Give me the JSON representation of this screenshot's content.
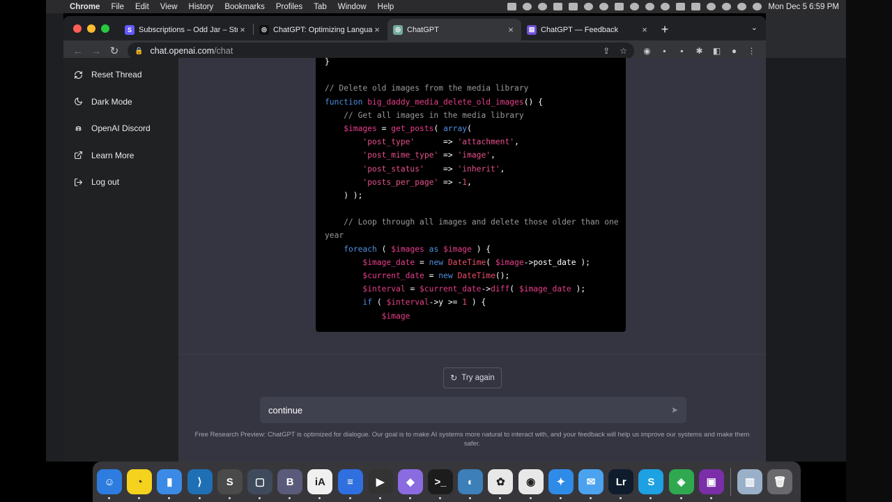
{
  "menubar": {
    "apple": "",
    "items": [
      "Chrome",
      "File",
      "Edit",
      "View",
      "History",
      "Bookmarks",
      "Profiles",
      "Tab",
      "Window",
      "Help"
    ],
    "clock": "Mon Dec 5  6:59 PM"
  },
  "browser": {
    "tabs": [
      {
        "title": "Subscriptions – Odd Jar – Strip",
        "fav": "S",
        "fav_color": "#635bff",
        "active": false
      },
      {
        "title": "ChatGPT: Optimizing Languag",
        "fav": "◎",
        "fav_color": "#111111",
        "active": false
      },
      {
        "title": "ChatGPT",
        "fav": "◎",
        "fav_color": "#74aa9c",
        "active": true
      },
      {
        "title": "ChatGPT — Feedback",
        "fav": "▤",
        "fav_color": "#6e4fd8",
        "active": false
      }
    ],
    "url_host": "chat.openai.com",
    "url_path": "/chat"
  },
  "sidebar": {
    "items": [
      {
        "label": "Reset Thread",
        "icon": "refresh-icon"
      },
      {
        "label": "Dark Mode",
        "icon": "moon-icon"
      },
      {
        "label": "OpenAI Discord",
        "icon": "discord-icon"
      },
      {
        "label": "Learn More",
        "icon": "external-link-icon"
      },
      {
        "label": "Log out",
        "icon": "logout-icon"
      }
    ]
  },
  "code": [
    [
      [
        "}",
        "pl"
      ]
    ],
    [],
    [
      [
        "// Delete old images from the media library",
        "com"
      ]
    ],
    [
      [
        "function",
        "kw"
      ],
      [
        " ",
        "pl"
      ],
      [
        "big_daddy_media_delete_old_images",
        "fn"
      ],
      [
        "() {",
        "pl"
      ]
    ],
    [
      [
        "    // Get all images in the media library",
        "com"
      ]
    ],
    [
      [
        "    ",
        "pl"
      ],
      [
        "$images",
        "var"
      ],
      [
        " = ",
        "pl"
      ],
      [
        "get_posts",
        "fn"
      ],
      [
        "( ",
        "pl"
      ],
      [
        "array",
        "kw"
      ],
      [
        "(",
        "pl"
      ]
    ],
    [
      [
        "        ",
        "pl"
      ],
      [
        "'post_type'",
        "str"
      ],
      [
        "      => ",
        "pl"
      ],
      [
        "'attachment'",
        "str"
      ],
      [
        ",",
        "pl"
      ]
    ],
    [
      [
        "        ",
        "pl"
      ],
      [
        "'post_mime_type'",
        "str"
      ],
      [
        " => ",
        "pl"
      ],
      [
        "'image'",
        "str"
      ],
      [
        ",",
        "pl"
      ]
    ],
    [
      [
        "        ",
        "pl"
      ],
      [
        "'post_status'",
        "str"
      ],
      [
        "    => ",
        "pl"
      ],
      [
        "'inherit'",
        "str"
      ],
      [
        ",",
        "pl"
      ]
    ],
    [
      [
        "        ",
        "pl"
      ],
      [
        "'posts_per_page'",
        "str"
      ],
      [
        " => ",
        "pl"
      ],
      [
        "-",
        "pl"
      ],
      [
        "1",
        "num"
      ],
      [
        ",",
        "pl"
      ]
    ],
    [
      [
        "    ) );",
        "pl"
      ]
    ],
    [],
    [
      [
        "    // Loop through all images and delete those older than one",
        "com"
      ]
    ],
    [
      [
        "year",
        "com"
      ]
    ],
    [
      [
        "    ",
        "pl"
      ],
      [
        "foreach",
        "kw"
      ],
      [
        " ( ",
        "pl"
      ],
      [
        "$images",
        "var"
      ],
      [
        " ",
        "pl"
      ],
      [
        "as",
        "kw"
      ],
      [
        " ",
        "pl"
      ],
      [
        "$image",
        "var"
      ],
      [
        " ) {",
        "pl"
      ]
    ],
    [
      [
        "        ",
        "pl"
      ],
      [
        "$image_date",
        "var"
      ],
      [
        " = ",
        "pl"
      ],
      [
        "new",
        "kw"
      ],
      [
        " ",
        "pl"
      ],
      [
        "DateTime",
        "cls"
      ],
      [
        "( ",
        "pl"
      ],
      [
        "$image",
        "var"
      ],
      [
        "->post_date );",
        "pl"
      ]
    ],
    [
      [
        "        ",
        "pl"
      ],
      [
        "$current_date",
        "var"
      ],
      [
        " = ",
        "pl"
      ],
      [
        "new",
        "kw"
      ],
      [
        " ",
        "pl"
      ],
      [
        "DateTime",
        "cls"
      ],
      [
        "();",
        "pl"
      ]
    ],
    [
      [
        "        ",
        "pl"
      ],
      [
        "$interval",
        "var"
      ],
      [
        " = ",
        "pl"
      ],
      [
        "$current_date",
        "var"
      ],
      [
        "->",
        "pl"
      ],
      [
        "diff",
        "fn"
      ],
      [
        "( ",
        "pl"
      ],
      [
        "$image_date",
        "var"
      ],
      [
        " );",
        "pl"
      ]
    ],
    [
      [
        "        ",
        "pl"
      ],
      [
        "if",
        "kw"
      ],
      [
        " ( ",
        "pl"
      ],
      [
        "$interval",
        "var"
      ],
      [
        "->y >= ",
        "pl"
      ],
      [
        "1",
        "num"
      ],
      [
        " ) {",
        "pl"
      ]
    ],
    [
      [
        "            ",
        "pl"
      ],
      [
        "$image",
        "var"
      ]
    ]
  ],
  "retry_label": "Try again",
  "prompt": {
    "value": "continue",
    "placeholder": ""
  },
  "disclaimer": "Free Research Preview: ChatGPT is optimized for dialogue. Our goal is to make AI systems more natural to interact with, and your feedback will help us improve our systems and make them safer.",
  "dock": [
    {
      "name": "finder",
      "color": "#2d7de0",
      "glyph": "☺"
    },
    {
      "name": "app-yellow",
      "color": "#f4d21d",
      "glyph": "◔"
    },
    {
      "name": "bookmarks-app",
      "color": "#3b8be6",
      "glyph": "▮"
    },
    {
      "name": "vscode",
      "color": "#1f6fb5",
      "glyph": "⟩"
    },
    {
      "name": "sublime-text",
      "color": "#4a4a4a",
      "glyph": "S"
    },
    {
      "name": "screenshot-app",
      "color": "#3f4b5c",
      "glyph": "▢"
    },
    {
      "name": "bbedit",
      "color": "#5a5a7a",
      "glyph": "B"
    },
    {
      "name": "ia-writer",
      "color": "#f0f0f0",
      "glyph": "iA"
    },
    {
      "name": "docs-app",
      "color": "#2f6fe0",
      "glyph": "≡"
    },
    {
      "name": "final-cut",
      "color": "#333333",
      "glyph": "▶"
    },
    {
      "name": "archive-app",
      "color": "#8a6be0",
      "glyph": "◆"
    },
    {
      "name": "terminal",
      "color": "#1c1c1c",
      "glyph": ">_"
    },
    {
      "name": "sequel-pro",
      "color": "#3d7fb8",
      "glyph": "◐"
    },
    {
      "name": "photos-app",
      "color": "#e8e8e8",
      "glyph": "✿"
    },
    {
      "name": "chrome",
      "color": "#e8e8e8",
      "glyph": "◉"
    },
    {
      "name": "safari",
      "color": "#2f8be8",
      "glyph": "✦"
    },
    {
      "name": "mail",
      "color": "#4ba3f0",
      "glyph": "✉"
    },
    {
      "name": "lightroom",
      "color": "#0f1c2e",
      "glyph": "Lr"
    },
    {
      "name": "skype",
      "color": "#1da1e2",
      "glyph": "S"
    },
    {
      "name": "vpn-app",
      "color": "#2fa84f",
      "glyph": "◈"
    },
    {
      "name": "screen-recorder",
      "color": "#7a2ea8",
      "glyph": "▣"
    },
    {
      "name": "downloads-folder",
      "color": "#9ab0c8",
      "glyph": "▥"
    },
    {
      "name": "trash",
      "color": "#6a6a6e",
      "glyph": "🗑"
    }
  ]
}
